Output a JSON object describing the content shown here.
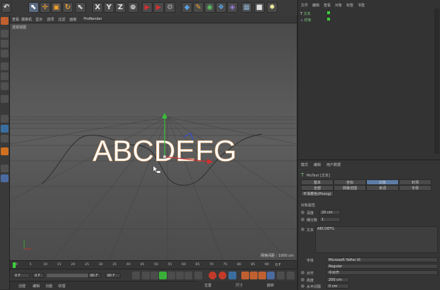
{
  "viewport": {
    "menu": [
      "查看",
      "摄像机",
      "显示",
      "选项",
      "过滤",
      "面板",
      "ProRender"
    ],
    "label": "透视视图",
    "grid_info": "网格间距 : 1000 cm",
    "text_3d": "ABCDEFG"
  },
  "timeline": {
    "ticks": [
      "0",
      "5",
      "10",
      "15",
      "20",
      "25",
      "30",
      "35",
      "40",
      "45",
      "50",
      "55",
      "60",
      "65",
      "70",
      "75",
      "80",
      "85",
      "90"
    ],
    "end_frame": "0 F"
  },
  "transport": {
    "current": "0 F",
    "start": "0 F",
    "end": "90 F",
    "end2": "90 F"
  },
  "materials_panel": {
    "items": [
      "创建",
      "编辑",
      "功能",
      "纹理"
    ]
  },
  "coords_panel": {
    "items": [
      "位置",
      "尺寸",
      "旋转"
    ]
  },
  "object_manager": {
    "menu": [
      "文件",
      "编辑",
      "查看",
      "对象",
      "标签",
      "书签"
    ],
    "objects": [
      "文本",
      "样条"
    ]
  },
  "attribute_manager": {
    "menu": [
      "模式",
      "编辑",
      "用户数据"
    ],
    "object_title": "MoText [文本]",
    "tabs_row1": [
      "基本",
      "坐标",
      "对象",
      "封顶"
    ],
    "tabs_row2": [
      "全部",
      "网格范围",
      "单词",
      "字母"
    ],
    "tabs_row3": [
      "平滑着色(Phong)"
    ],
    "section": "对象属性",
    "depth_label": "深度",
    "depth_value": "20 cm",
    "subdiv_label": "细分数",
    "subdiv_value": "1",
    "text_label": "文本",
    "text_value": "ABCDEFG",
    "font_label": "字体",
    "font_value": "Microsoft YaHei UI",
    "style_value": "Regular",
    "align_label": "对齐",
    "align_value": "中对齐",
    "height_label": "高度",
    "height_value": "200 cm",
    "hspacing_label": "水平间隔",
    "hspacing_value": "0 cm"
  },
  "icons": [
    "undo-icon",
    "select-icon",
    "move-icon",
    "scale-icon",
    "rotate-icon",
    "axis-x-icon",
    "axis-y-icon",
    "axis-z-icon",
    "coord-system-icon",
    "render-icon",
    "cube-icon",
    "pen-icon",
    "subdivide-icon",
    "deformer-icon",
    "floor-icon",
    "camera-icon",
    "light-icon"
  ]
}
